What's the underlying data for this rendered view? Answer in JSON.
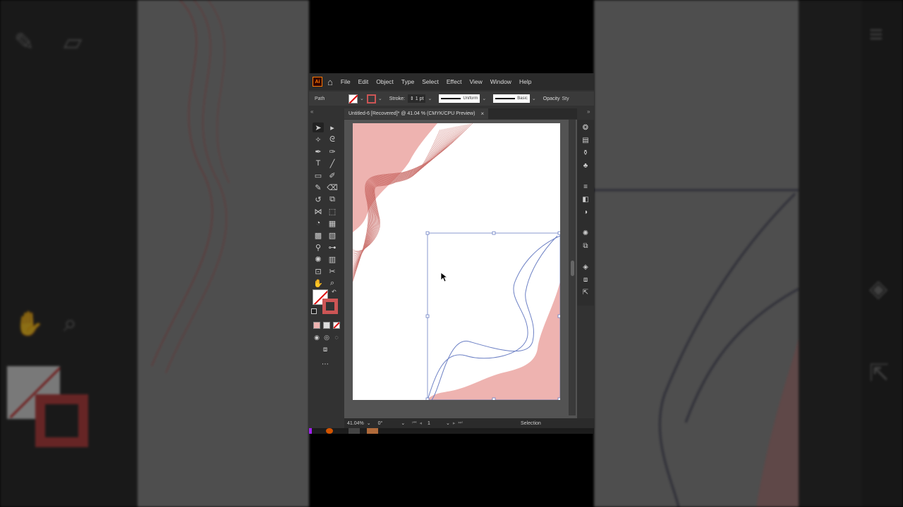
{
  "menubar": {
    "app_logo": "Ai",
    "items": [
      "File",
      "Edit",
      "Object",
      "Type",
      "Select",
      "Effect",
      "View",
      "Window",
      "Help"
    ]
  },
  "controlbar": {
    "selection_type": "Path",
    "stroke_label": "Stroke:",
    "stroke_weight": "1 pt",
    "profile": "Uniform",
    "brush": "Basic",
    "opacity_label": "Opacity",
    "style_label": "Sty"
  },
  "document": {
    "tab_title": "Untitled-6 [Recovered]* @ 41.04 % (CMYK/CPU Preview)",
    "close_glyph": "×"
  },
  "statusbar": {
    "zoom": "41.04%",
    "rotation": "0°",
    "artboard_number": "1",
    "tool_name": "Selection"
  },
  "colors": {
    "accent_pink": "#eeb3b0",
    "wave_line": "#c25a55",
    "selection_blue": "#6b7fc4",
    "app_logo_orange": "#ff7b00"
  }
}
